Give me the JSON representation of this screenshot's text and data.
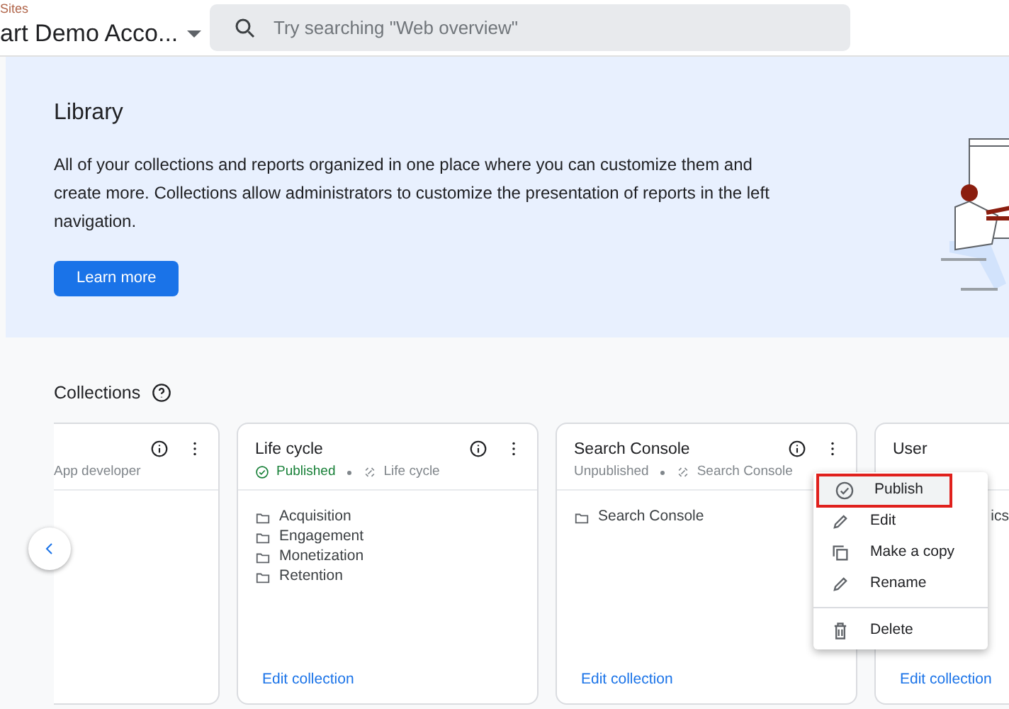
{
  "header": {
    "account_label": "Sites",
    "account_name": "art Demo Acco...",
    "search": {
      "placeholder": "Try searching \"Web overview\""
    }
  },
  "banner": {
    "title": "Library",
    "text": "All of your collections and reports organized in one place where you can customize them and create more. Collections allow administrators to customize the presentation of reports in the left navigation.",
    "button": "Learn more"
  },
  "collections": {
    "title": "Collections",
    "cards": [
      {
        "kind": "clipped",
        "source": "App developer"
      },
      {
        "kind": "full",
        "title": "Life cycle",
        "status": "Published",
        "published": true,
        "source": "Life cycle",
        "items": [
          "Acquisition",
          "Engagement",
          "Monetization",
          "Retention"
        ],
        "edit": "Edit collection"
      },
      {
        "kind": "full",
        "title": "Search Console",
        "status": "Unpublished",
        "published": false,
        "source": "Search Console",
        "items": [
          "Search Console"
        ],
        "edit": "Edit collection"
      },
      {
        "kind": "covered",
        "title": "User",
        "items": [
          "ics"
        ],
        "edit": "Edit collection"
      }
    ]
  },
  "menu": {
    "items": [
      {
        "kind": "publish",
        "label": "Publish",
        "selected": true
      },
      {
        "kind": "edit",
        "label": "Edit",
        "selected": false
      },
      {
        "kind": "copy",
        "label": "Make a copy",
        "selected": false
      },
      {
        "kind": "rename",
        "label": "Rename",
        "selected": false
      },
      {
        "kind": "delete",
        "label": "Delete",
        "selected": false
      }
    ]
  }
}
